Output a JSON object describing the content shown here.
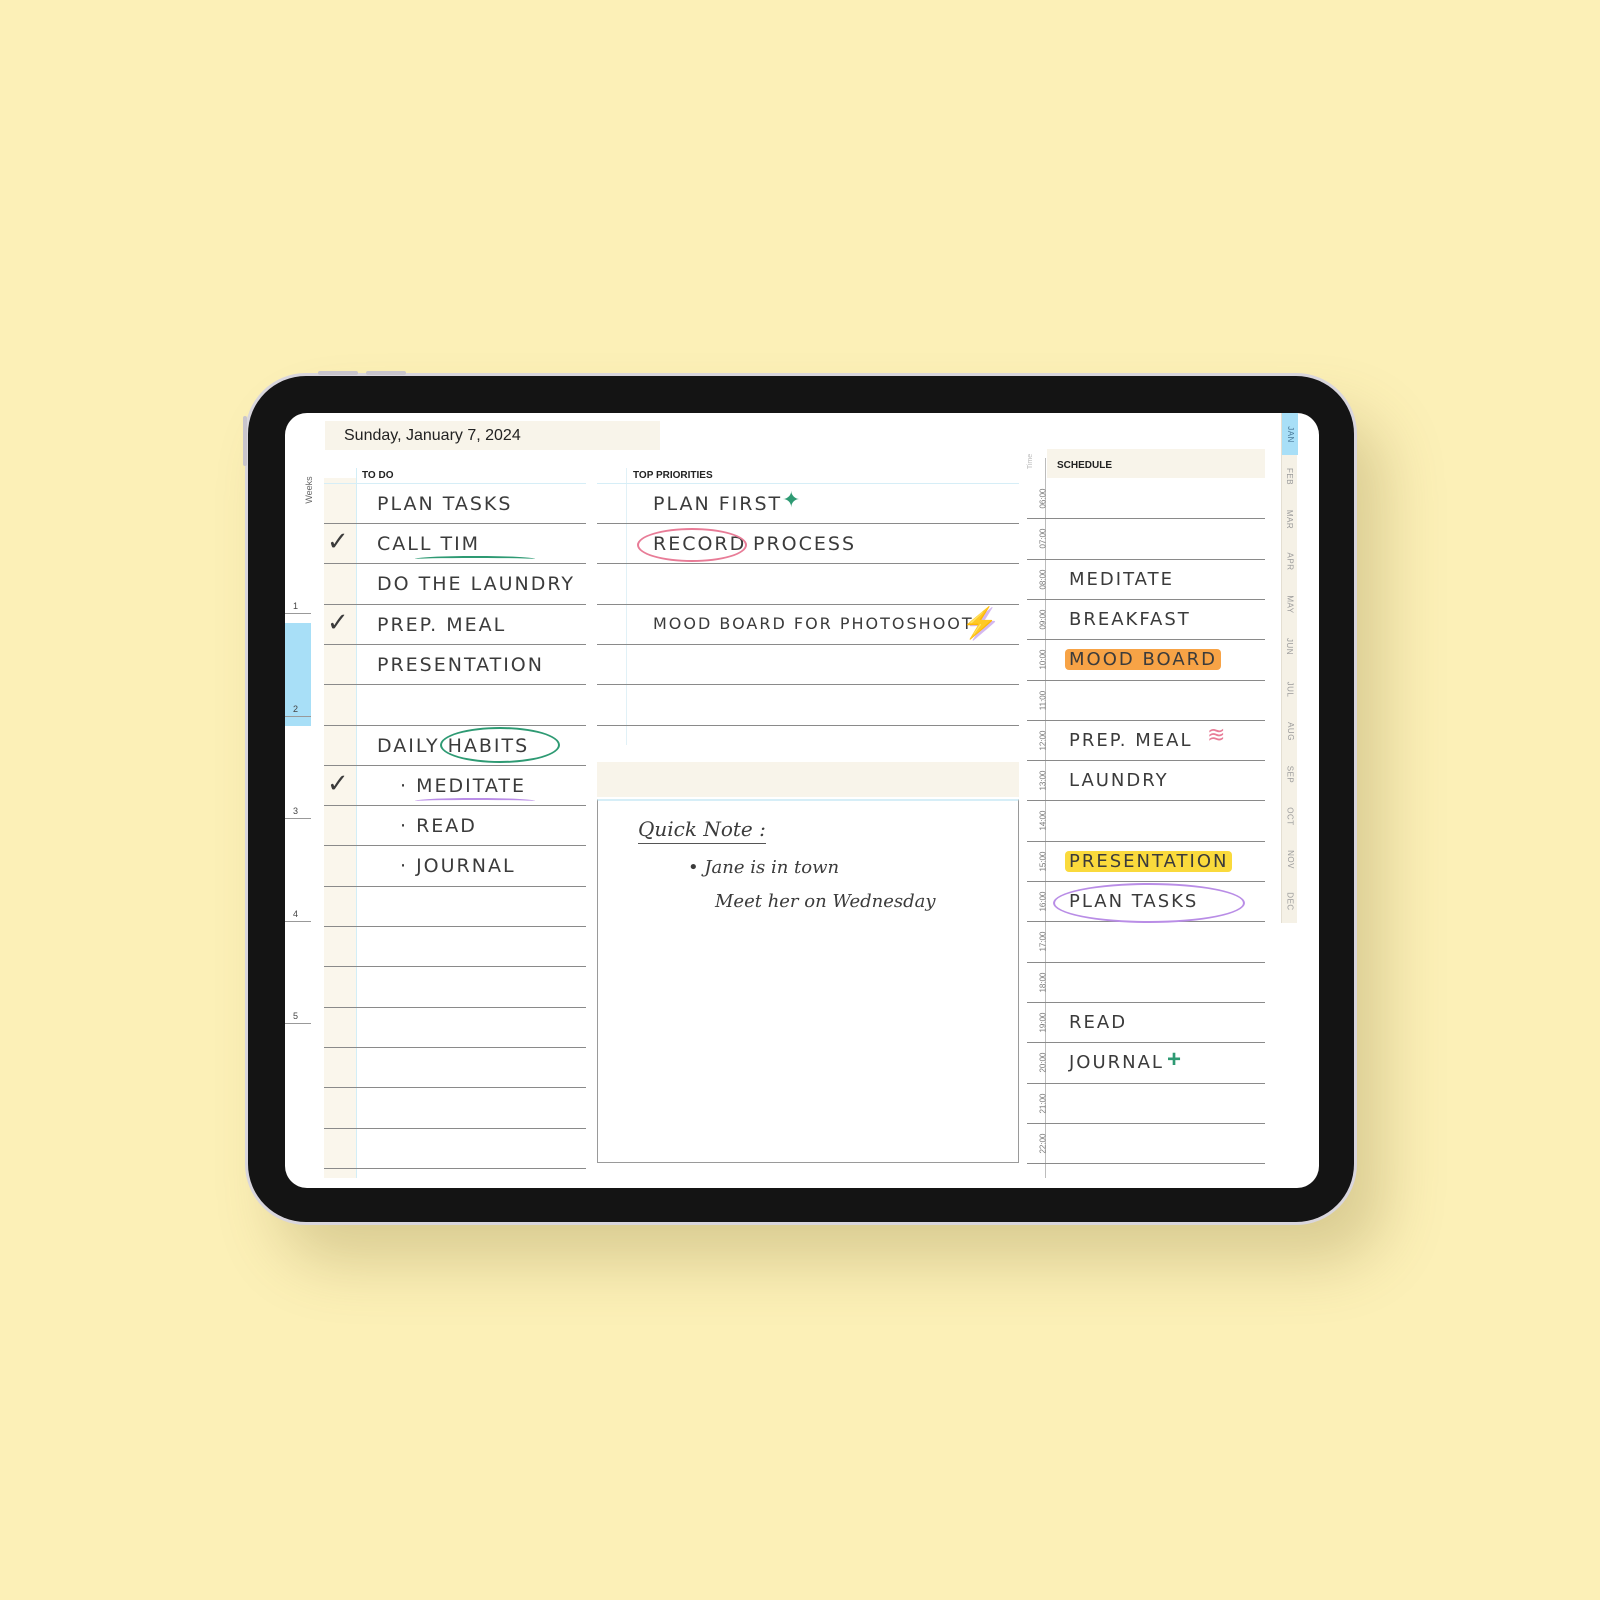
{
  "header": {
    "date": "Sunday, January 7, 2024"
  },
  "weeks": {
    "label": "Weeks",
    "numbers": [
      "1",
      "2",
      "3",
      "4",
      "5"
    ],
    "active_week": "2"
  },
  "todo": {
    "title": "TO DO",
    "items": [
      {
        "text": "PLAN  TASKS",
        "checked": false
      },
      {
        "text": "CALL  TIM",
        "checked": true,
        "underline_color": "#2e9a73"
      },
      {
        "text": "DO THE LAUNDRY",
        "checked": false
      },
      {
        "text": "PREP.  MEAL",
        "checked": true
      },
      {
        "text": "PRESENTATION",
        "checked": false
      },
      {
        "text": "",
        "checked": false
      },
      {
        "text": "DAILY HABITS",
        "checked": false,
        "circle_color": "#2e9a73"
      },
      {
        "text": "· MEDITATE",
        "checked": true,
        "underline_color": "#b98de6"
      },
      {
        "text": "· READ",
        "checked": false
      },
      {
        "text": "· JOURNAL",
        "checked": false
      }
    ],
    "check_glyph": "✓"
  },
  "priorities": {
    "title": "TOP PRIORITIES",
    "items": [
      {
        "text": "PLAN  FIRST",
        "decoration": "sparkle-icon",
        "decoration_color": "#2e9a73"
      },
      {
        "text": "RECORD",
        "suffix": "PROCESS",
        "circle_color": "#e87c97"
      },
      {
        "text": ""
      },
      {
        "text": "MOOD  BOARD  FOR  PHOTOSHOOT",
        "decoration": "lightning-icon",
        "decoration_color": "#2e9a73"
      },
      {
        "text": ""
      },
      {
        "text": ""
      }
    ]
  },
  "quick_note": {
    "title": "Quick Note :",
    "line1": "• Jane is in town",
    "line2": "Meet her on Wednesday"
  },
  "schedule": {
    "title": "SCHEDULE",
    "time_label": "Time",
    "slots": [
      {
        "time": "06:00",
        "text": ""
      },
      {
        "time": "07:00",
        "text": ""
      },
      {
        "time": "08:00",
        "text": "MEDITATE"
      },
      {
        "time": "09:00",
        "text": "BREAKFAST"
      },
      {
        "time": "10:00",
        "text": "MOOD BOARD",
        "highlight": "#f7a346"
      },
      {
        "time": "11:00",
        "text": ""
      },
      {
        "time": "12:00",
        "text": "PREP.  MEAL",
        "decoration": "squiggle-icon",
        "decoration_color": "#e87c97"
      },
      {
        "time": "13:00",
        "text": "LAUNDRY"
      },
      {
        "time": "14:00",
        "text": ""
      },
      {
        "time": "15:00",
        "text": "PRESENTATION",
        "highlight": "#fada3c"
      },
      {
        "time": "16:00",
        "text": "PLAN  TASKS",
        "circle_color": "#b98de6"
      },
      {
        "time": "17:00",
        "text": ""
      },
      {
        "time": "18:00",
        "text": ""
      },
      {
        "time": "19:00",
        "text": "READ"
      },
      {
        "time": "20:00",
        "text": "JOURNAL",
        "decoration": "plus-icon",
        "decoration_color": "#2e9a73"
      },
      {
        "time": "21:00",
        "text": ""
      },
      {
        "time": "22:00",
        "text": ""
      }
    ]
  },
  "months": {
    "items": [
      "JAN",
      "FEB",
      "MAR",
      "APR",
      "MAY",
      "JUN",
      "JUL",
      "AUG",
      "SEP",
      "OCT",
      "NOV",
      "DEC"
    ],
    "active": "JAN"
  },
  "colors": {
    "background": "#fcf0b7",
    "accent_blue": "#a8dff7",
    "paper_tint": "#f8f4ea",
    "ink": "#3b3b3b"
  }
}
